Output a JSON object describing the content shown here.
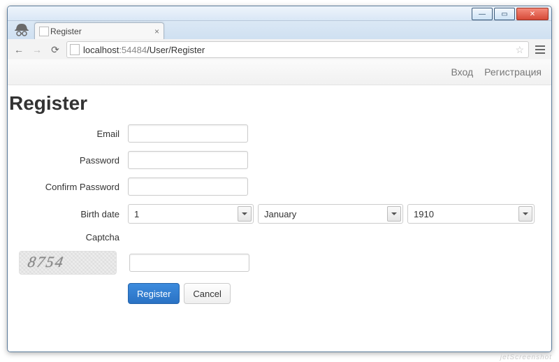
{
  "window": {
    "tab_title": "Register"
  },
  "address": {
    "host": "localhost",
    "port": ":54484",
    "path": "/User/Register"
  },
  "topnav": {
    "login": "Вход",
    "register": "Регистрация"
  },
  "page": {
    "heading": "Register"
  },
  "form": {
    "email_label": "Email",
    "email_value": "",
    "password_label": "Password",
    "password_value": "",
    "confirm_label": "Confirm Password",
    "confirm_value": "",
    "birthdate_label": "Birth date",
    "day_value": "1",
    "month_value": "January",
    "year_value": "1910",
    "captcha_label": "Captcha",
    "captcha_image_text": "8754",
    "captcha_value": "",
    "submit_label": "Register",
    "cancel_label": "Cancel"
  },
  "watermark": "jetScreenshot"
}
